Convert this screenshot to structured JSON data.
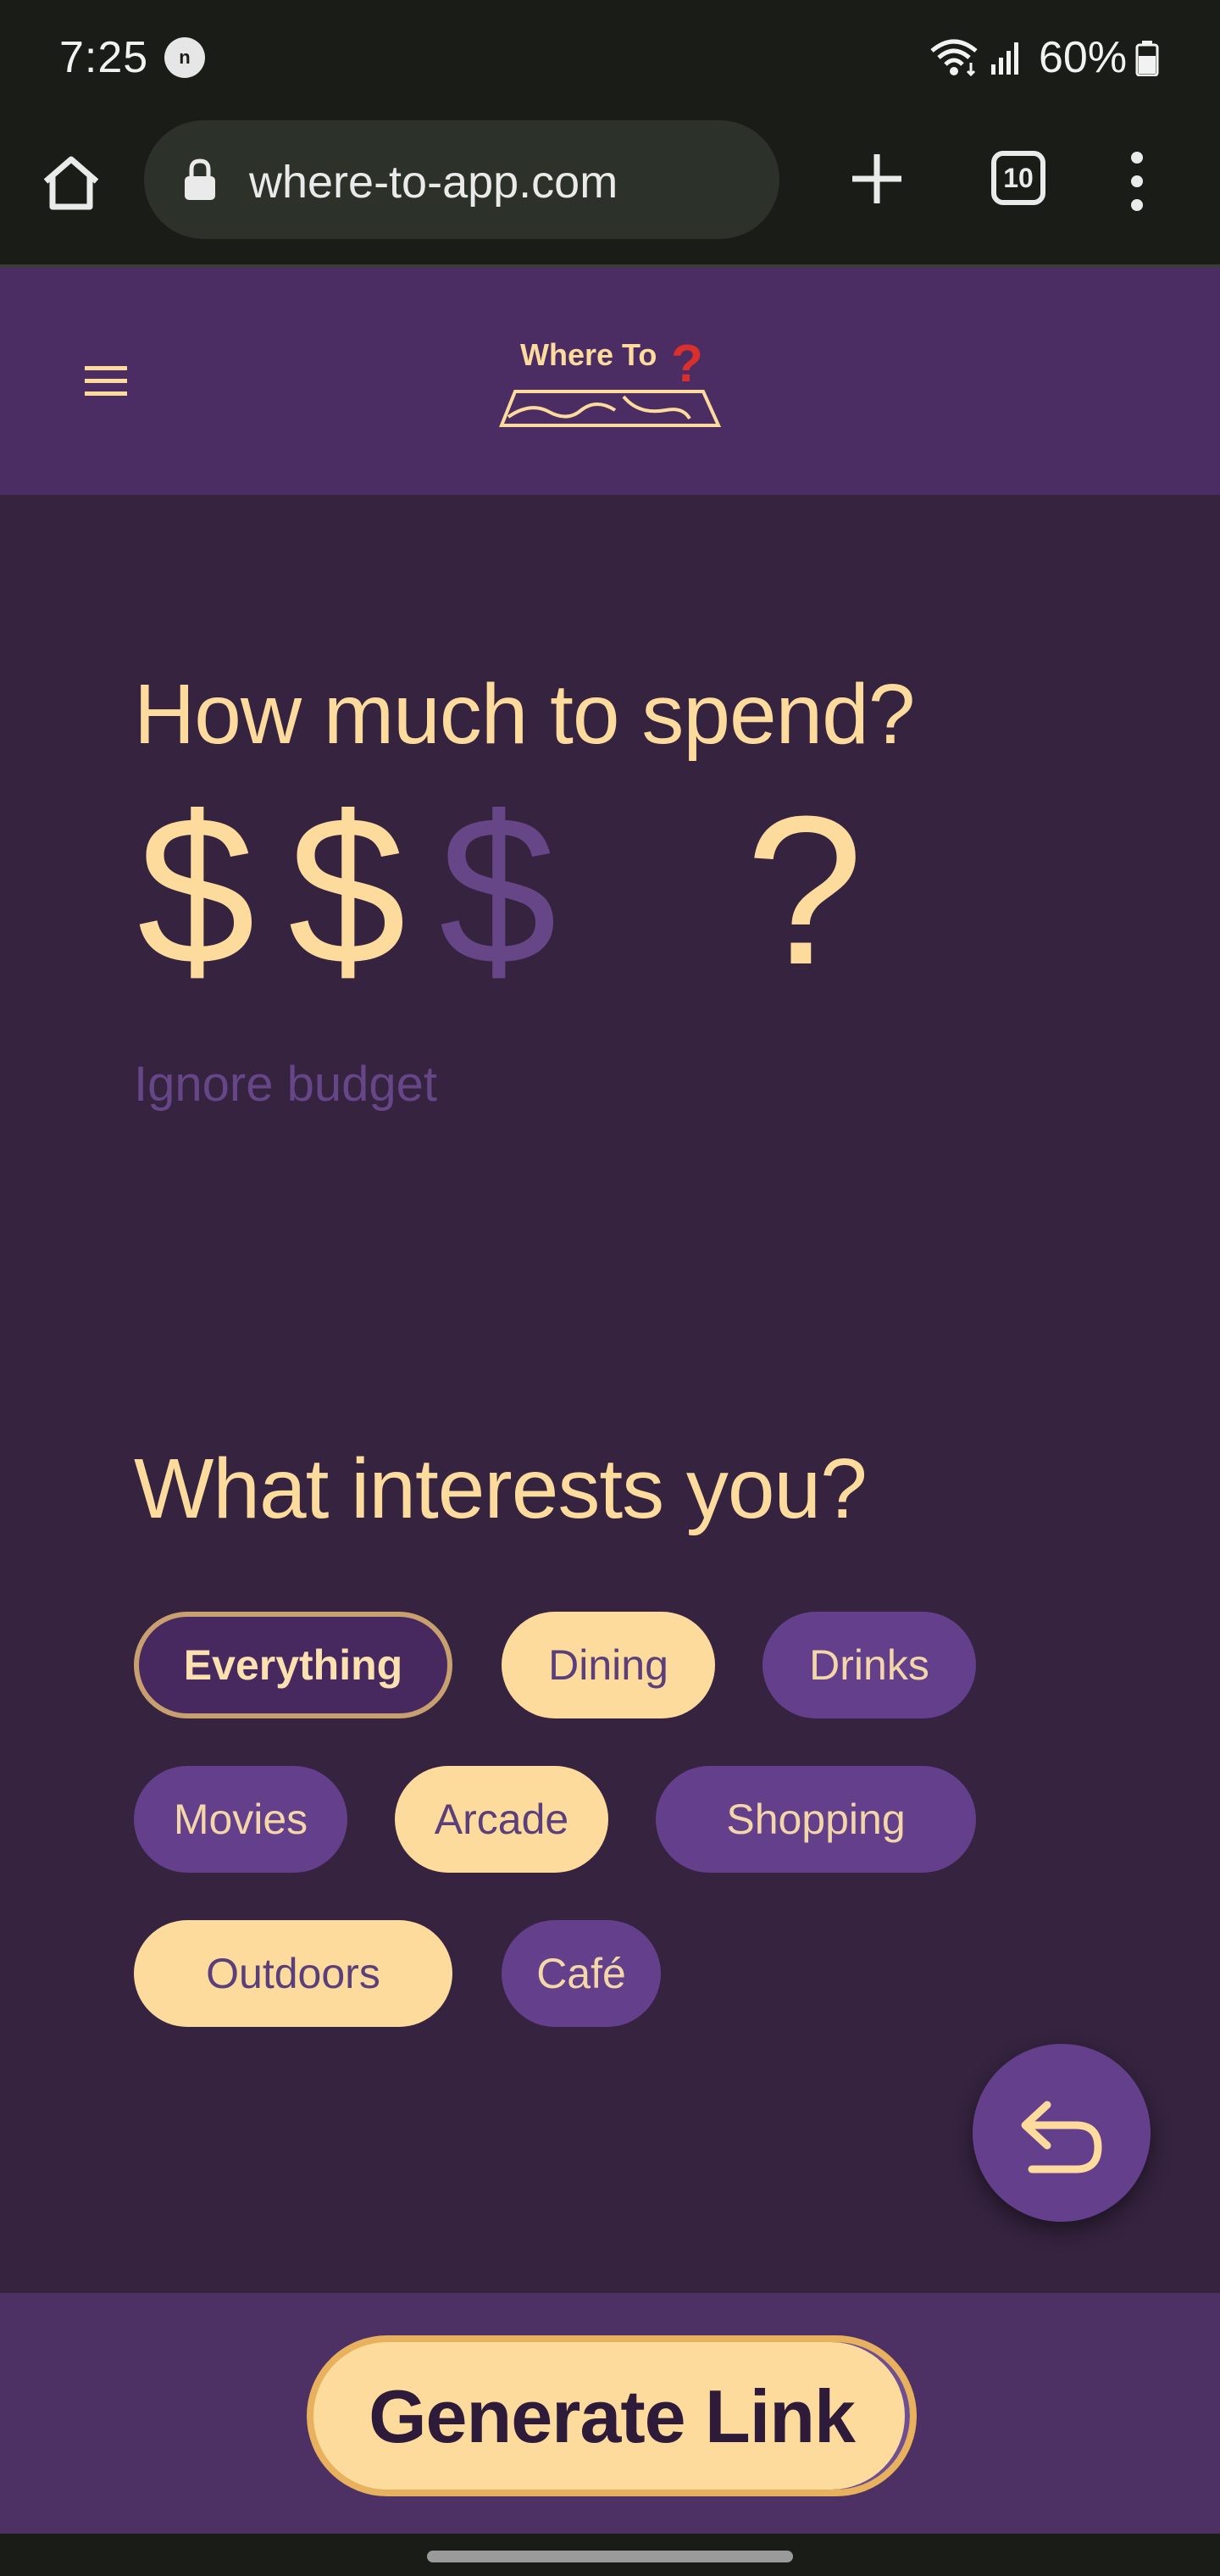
{
  "status_bar": {
    "time": "7:25",
    "notification_badge": "n",
    "battery_percent": "60%"
  },
  "browser": {
    "url": "where-to-app.com",
    "tab_count": "10"
  },
  "header": {
    "logo_text": "Where To"
  },
  "budget": {
    "title": "How much to spend?",
    "symbols": [
      "$",
      "$",
      "$"
    ],
    "level_selected": 2,
    "level_max": 3,
    "unknown_symbol": "?",
    "ignore_label": "Ignore budget"
  },
  "interests": {
    "title": "What interests you?",
    "chips": [
      {
        "label": "Everything",
        "selected": false,
        "style": "outlined"
      },
      {
        "label": "Dining",
        "selected": true
      },
      {
        "label": "Drinks",
        "selected": false
      },
      {
        "label": "Movies",
        "selected": false
      },
      {
        "label": "Arcade",
        "selected": true
      },
      {
        "label": "Shopping",
        "selected": false
      },
      {
        "label": "Outdoors",
        "selected": true
      },
      {
        "label": "Café",
        "selected": false
      }
    ]
  },
  "footer": {
    "generate_label": "Generate Link"
  },
  "colors": {
    "accent": "#fcdb9d",
    "primary": "#643f8c",
    "background": "#35233f",
    "header": "#4b2d63"
  },
  "icons": [
    "home-icon",
    "lock-icon",
    "plus-icon",
    "tabs-icon",
    "more-vert-icon",
    "hamburger-icon",
    "undo-icon",
    "wifi-icon",
    "signal-icon",
    "battery-icon"
  ]
}
